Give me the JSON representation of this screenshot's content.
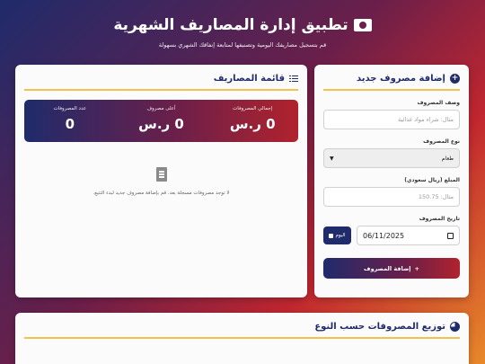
{
  "header": {
    "title": "تطبيق إدارة المصاريف الشهرية",
    "subtitle": "قم بتسجيل مصاريفك اليومية وتصنيفها لمتابعة إنفاقك الشهري بسهولة",
    "icon": "money-bill-icon"
  },
  "add_form": {
    "title": "إضافة مصروف جديد",
    "description_label": "وصف المصروف",
    "description_placeholder": "مثال: شراء مواد غذائية",
    "type_label": "نوع المصروف",
    "type_selected": "طعام",
    "amount_label": "المبلغ (ريال سعودي)",
    "amount_placeholder": "مثال: 150.75",
    "date_label": "تاريخ المصروف",
    "date_value": "06/11/2025",
    "today_button": "اليوم",
    "submit_button": "إضافة المصروف"
  },
  "expense_list": {
    "title": "قائمة المصاريف",
    "stats": [
      {
        "label": "إجمالي المصروفات",
        "value": "0 ر.س"
      },
      {
        "label": "أعلى مصروف",
        "value": "0 ر.س"
      },
      {
        "label": "عدد المصروفات",
        "value": "0"
      }
    ],
    "empty_message": "لا توجد مصروفات مسجلة بعد. قم بإضافة مصروف جديد لبدء التتبع."
  },
  "distribution": {
    "title": "توزيع المصروفات حسب النوع"
  },
  "colors": {
    "primary": "#1f2b6b",
    "accent": "#f2c14e",
    "red": "#b0232d"
  }
}
